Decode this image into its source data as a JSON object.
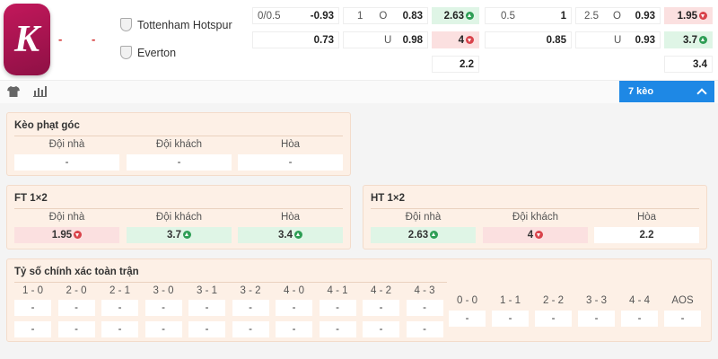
{
  "logo_letter": "K",
  "score_home": "-",
  "score_away": "-",
  "teams": {
    "home": "Tottenham Hotspur",
    "away": "Everton"
  },
  "odds": {
    "r1": {
      "h1_line": "0/0.5",
      "h1_val": "-0.93",
      "o1_line": "1",
      "o1_lab": "O",
      "o1_val": "0.83",
      "x1": "2.63",
      "h2_line": "0.5",
      "h2_val": "1",
      "o2_line": "2.5",
      "o2_lab": "O",
      "o2_val": "0.93",
      "x2": "1.95"
    },
    "r2": {
      "h1_val": "0.73",
      "o1_lab": "U",
      "o1_val": "0.98",
      "x1": "4",
      "h2_val": "0.85",
      "o2_lab": "U",
      "o2_val": "0.93",
      "x2": "3.7"
    },
    "r3": {
      "x1": "2.2",
      "x2": "3.4"
    }
  },
  "toolbar": {
    "more_label": "7 kèo"
  },
  "corner": {
    "title": "Kèo phạt góc",
    "headers": [
      "Đội nhà",
      "Đội khách",
      "Hòa"
    ],
    "values": [
      "-",
      "-",
      "-"
    ]
  },
  "ft": {
    "title": "FT 1×2",
    "headers": [
      "Đội nhà",
      "Đội khách",
      "Hòa"
    ],
    "values": [
      "1.95",
      "3.7",
      "3.4"
    ]
  },
  "ht": {
    "title": "HT 1×2",
    "headers": [
      "Đội nhà",
      "Đội khách",
      "Hòa"
    ],
    "values": [
      "2.63",
      "4",
      "2.2"
    ]
  },
  "exact": {
    "title": "Tỷ số chính xác toàn trận",
    "left_headers": [
      "1 - 0",
      "2 - 0",
      "2 - 1",
      "3 - 0",
      "3 - 1",
      "3 - 2",
      "4 - 0",
      "4 - 1",
      "4 - 2",
      "4 - 3"
    ],
    "right_headers": [
      "0 - 0",
      "1 - 1",
      "2 - 2",
      "3 - 3",
      "4 - 4",
      "AOS"
    ],
    "empty": "-"
  },
  "colors": {
    "up": "#2e9e55",
    "down": "#d9434b",
    "accent": "#1e88e5",
    "brand": "#c2185b"
  }
}
